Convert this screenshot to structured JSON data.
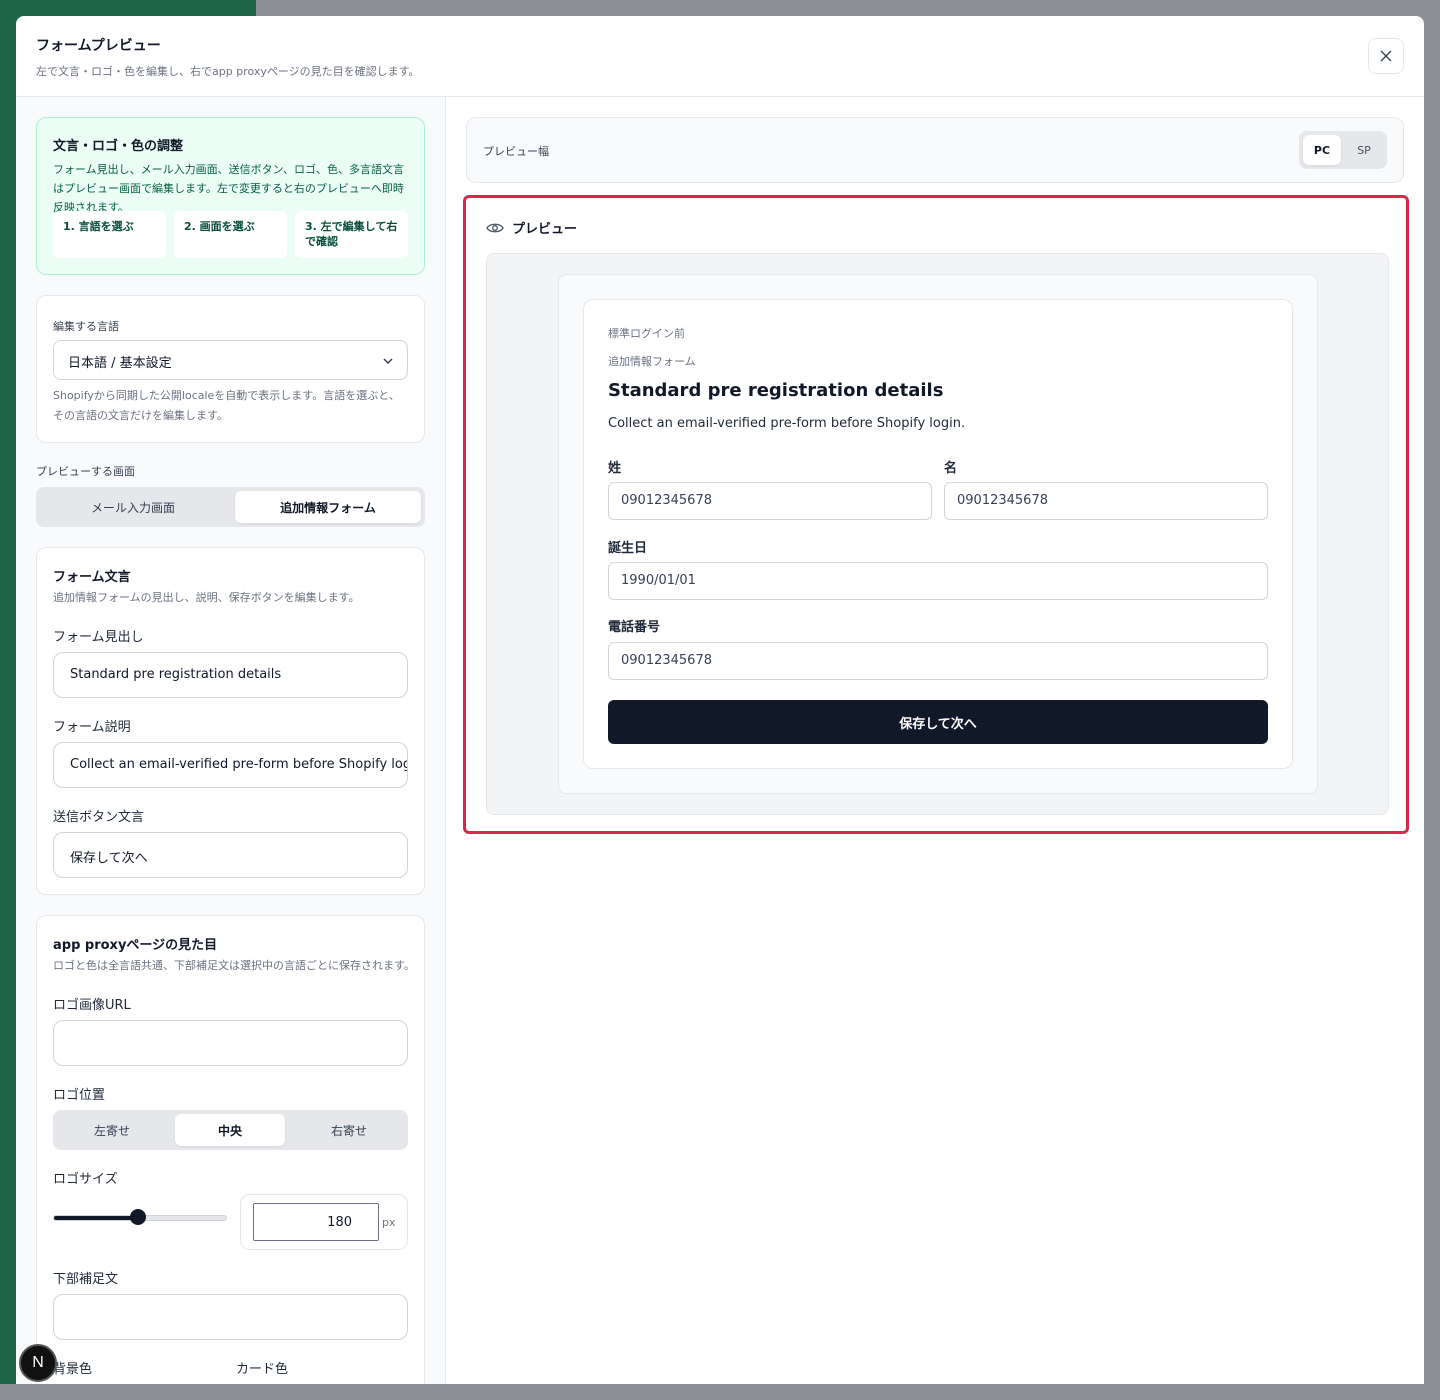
{
  "modal": {
    "title": "フォームプレビュー",
    "subtitle": "左で文言・ロゴ・色を編集し、右でapp proxyページの見た目を確認します。"
  },
  "guide": {
    "title": "文言・ロゴ・色の調整",
    "text": "フォーム見出し、メール入力画面、送信ボタン、ロゴ、色、多言語文言はプレビュー画面で編集します。左で変更すると右のプレビューへ即時反映されます。",
    "steps": [
      "1. 言語を選ぶ",
      "2. 画面を選ぶ",
      "3. 左で編集して右で確認"
    ]
  },
  "language": {
    "label": "編集する言語",
    "selected": "日本語 / 基本設定",
    "help": "Shopifyから同期した公開localeを自動で表示します。言語を選ぶと、その言語の文言だけを編集します。"
  },
  "screen": {
    "label": "プレビューする画面",
    "options": [
      "メール入力画面",
      "追加情報フォーム"
    ],
    "active": "追加情報フォーム"
  },
  "form_text": {
    "title": "フォーム文言",
    "help": "追加情報フォームの見出し、説明、保存ボタンを編集します。",
    "heading_label": "フォーム見出し",
    "heading_value": "Standard pre registration details",
    "desc_label": "フォーム説明",
    "desc_value": "Collect an email-verified pre-form before Shopify login.",
    "button_label": "送信ボタン文言",
    "button_value": "保存して次へ"
  },
  "appearance": {
    "title": "app proxyページの見た目",
    "help": "ロゴと色は全言語共通、下部補足文は選択中の言語ごとに保存されます。",
    "logo_url_label": "ロゴ画像URL",
    "logo_url_value": "",
    "logo_pos_label": "ロゴ位置",
    "logo_pos_options": [
      "左寄せ",
      "中央",
      "右寄せ"
    ],
    "logo_pos_active": "中央",
    "logo_size_label": "ロゴサイズ",
    "logo_size_value": "180",
    "logo_size_unit": "px",
    "logo_size_fraction": 0.49,
    "footer_label": "下部補足文",
    "footer_value": "",
    "bg_color_label": "背景色",
    "card_color_label": "カード色"
  },
  "preview": {
    "width_label": "プレビュー幅",
    "width_options": [
      "PC",
      "SP"
    ],
    "width_active": "PC",
    "title": "プレビュー",
    "eyebrow1": "標準ログイン前",
    "eyebrow2": "追加情報フォーム",
    "heading": "Standard pre registration details",
    "description": "Collect an email-verified pre-form before Shopify login.",
    "last_name_label": "姓",
    "last_name_value": "09012345678",
    "first_name_label": "名",
    "first_name_value": "09012345678",
    "birthday_label": "誕生日",
    "birthday_value": "1990/01/01",
    "phone_label": "電話番号",
    "phone_value": "09012345678",
    "submit": "保存して次へ"
  },
  "badge": "N",
  "colors": {
    "accent_border": "#dc2647",
    "primary": "#111827",
    "guide_bg": "#ecfdf5"
  }
}
